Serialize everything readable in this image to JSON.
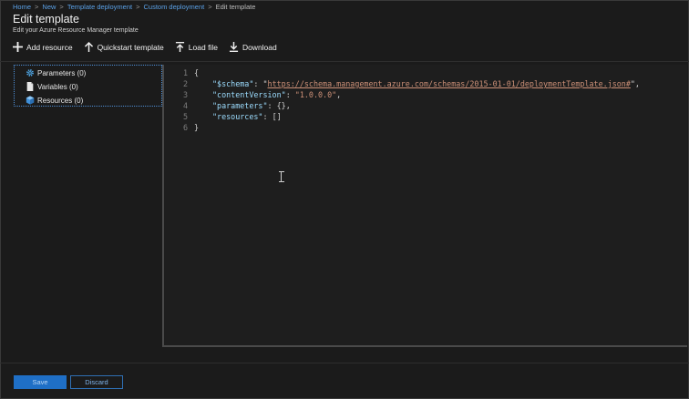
{
  "breadcrumb": [
    "Home",
    "New",
    "Template deployment",
    "Custom deployment",
    "Edit template"
  ],
  "header": {
    "title": "Edit template",
    "subtitle": "Edit your Azure Resource Manager template"
  },
  "toolbar": {
    "add_resource": "Add resource",
    "quickstart": "Quickstart template",
    "load_file": "Load file",
    "download": "Download"
  },
  "sidebar": {
    "items": [
      {
        "label": "Parameters (0)",
        "icon": "gear-icon"
      },
      {
        "label": "Variables (0)",
        "icon": "document-icon"
      },
      {
        "label": "Resources (0)",
        "icon": "cube-icon"
      }
    ]
  },
  "editor": {
    "line_numbers": [
      "1",
      "2",
      "3",
      "4",
      "5",
      "6"
    ],
    "lines": {
      "l1": "{",
      "schema_key": "\"$schema\"",
      "schema_url": "https://schema.management.azure.com/schemas/2015-01-01/deploymentTemplate.json#",
      "cv_key": "\"contentVersion\"",
      "cv_val": "\"1.0.0.0\"",
      "params_key": "\"parameters\"",
      "params_val": "{},",
      "res_key": "\"resources\"",
      "res_val": "[]",
      "l6": "}"
    }
  },
  "footer": {
    "save": "Save",
    "discard": "Discard"
  },
  "colors": {
    "accent": "#1f6fc6",
    "link": "#5aa0e6",
    "json_key": "#9cdcfe",
    "json_string": "#ce9178"
  }
}
